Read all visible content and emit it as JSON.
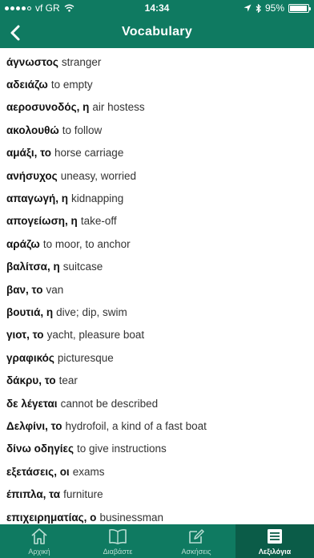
{
  "status_bar": {
    "carrier": "vf GR",
    "time": "14:34",
    "battery_text": "95%",
    "battery_level": 0.95
  },
  "header": {
    "title": "Vocabulary",
    "back_icon": "chevron-left-icon"
  },
  "colors": {
    "bar": "#0f7a61",
    "active_tab": "#0b5c48"
  },
  "vocabulary": [
    {
      "greek": "άγνωστος",
      "english": "stranger"
    },
    {
      "greek": "αδειάζω",
      "english": "to empty"
    },
    {
      "greek": "αεροσυνοδός, η",
      "english": "air hostess"
    },
    {
      "greek": "ακολουθώ",
      "english": "to follow"
    },
    {
      "greek": "αμάξι, το",
      "english": "horse carriage"
    },
    {
      "greek": "ανήσυχος",
      "english": "uneasy, worried"
    },
    {
      "greek": "απαγωγή, η",
      "english": "kidnapping"
    },
    {
      "greek": "απογείωση, η",
      "english": "take-off"
    },
    {
      "greek": "αράζω",
      "english": "to moor, to anchor"
    },
    {
      "greek": "βαλίτσα, η",
      "english": "suitcase"
    },
    {
      "greek": "βαν, το",
      "english": "van"
    },
    {
      "greek": "βουτιά, η",
      "english": "dive; dip, swim"
    },
    {
      "greek": "γιοτ, το",
      "english": "yacht, pleasure boat"
    },
    {
      "greek": "γραφικός",
      "english": "picturesque"
    },
    {
      "greek": "δάκρυ, το",
      "english": "tear"
    },
    {
      "greek": "δε λέγεται",
      "english": "cannot be described"
    },
    {
      "greek": "Δελφίνι, το",
      "english": "hydrofoil, a kind of a fast boat"
    },
    {
      "greek": "δίνω οδηγίες",
      "english": "to give instructions"
    },
    {
      "greek": "εξετάσεις, οι",
      "english": "exams"
    },
    {
      "greek": "έπιπλα, τα",
      "english": "furniture"
    },
    {
      "greek": "επιχειρηματίας, ο",
      "english": "businessman"
    }
  ],
  "tabs": [
    {
      "label": "Αρχική",
      "icon": "home-icon",
      "active": false
    },
    {
      "label": "Διαβάστε",
      "icon": "book-icon",
      "active": false
    },
    {
      "label": "Ασκήσεις",
      "icon": "edit-icon",
      "active": false
    },
    {
      "label": "Λεξιλόγια",
      "icon": "list-icon",
      "active": true
    }
  ]
}
